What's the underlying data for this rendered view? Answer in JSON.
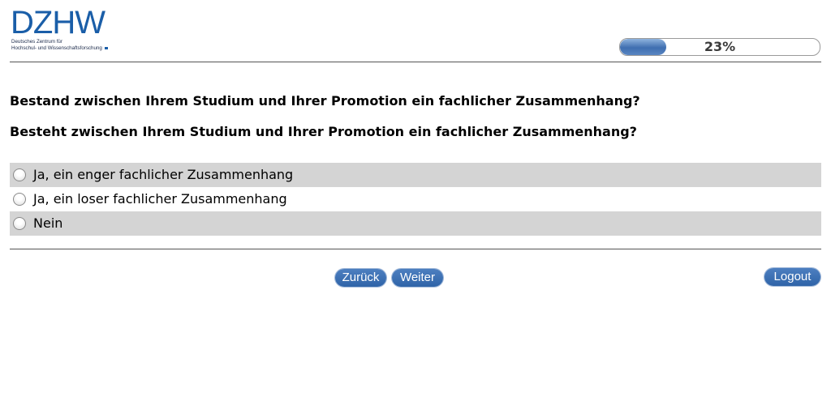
{
  "header": {
    "logo": {
      "mark": "DZHW",
      "subtitle_line1": "Deutsches Zentrum für",
      "subtitle_line2": "Hochschul- und Wissenschaftsforschung"
    },
    "progress": {
      "percent": 23,
      "label": "23%"
    }
  },
  "main": {
    "questions": [
      "Bestand zwischen Ihrem Studium und Ihrer Promotion ein fachlicher Zusammenhang?",
      "Besteht zwischen Ihrem Studium und Ihrer Promotion ein fachlicher Zusammenhang?"
    ],
    "options": [
      {
        "label": "Ja, ein enger fachlicher Zusammenhang",
        "selected": false
      },
      {
        "label": "Ja, ein loser fachlicher Zusammenhang",
        "selected": false
      },
      {
        "label": "Nein",
        "selected": false
      }
    ]
  },
  "footer": {
    "back_label": "Zurück",
    "next_label": "Weiter",
    "logout_label": "Logout"
  },
  "colors": {
    "brand": "#1a5ea8",
    "button": "#2f64a8",
    "row_shade": "#d4d4d4"
  }
}
